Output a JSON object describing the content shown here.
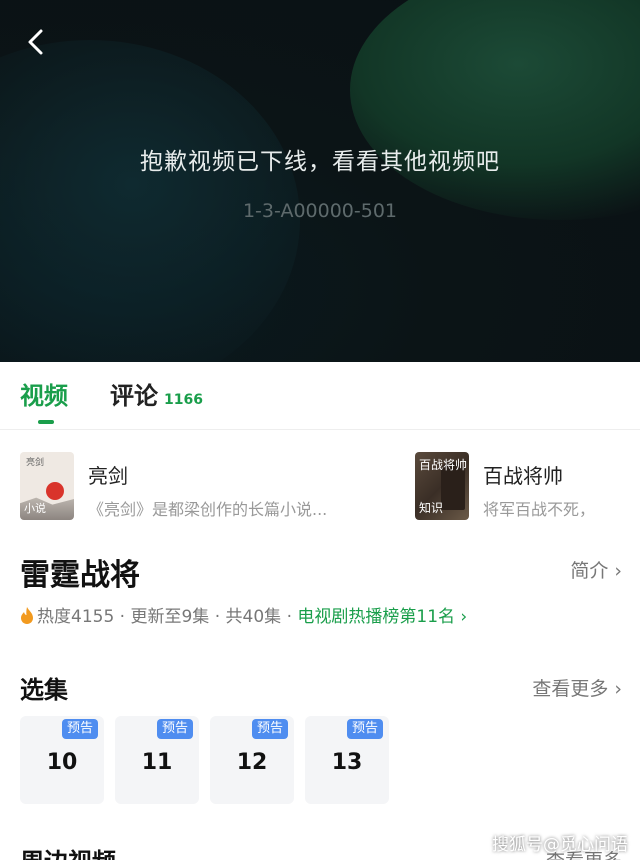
{
  "player": {
    "message": "抱歉视频已下线，看看其他视频吧",
    "error_code": "1-3-A00000-501",
    "back_icon": "chevron-left-icon"
  },
  "tabs": [
    {
      "label": "视频",
      "active": true
    },
    {
      "label": "评论",
      "count": "1166",
      "active": false
    }
  ],
  "related": [
    {
      "title": "亮剑",
      "desc": "《亮剑》是都梁创作的长篇小说...",
      "thumb_tag": "小说",
      "thumb_text": "亮剑"
    },
    {
      "title": "百战将帅",
      "desc": "将军百战不死，",
      "thumb_tag": "知识",
      "thumb_text": "百战将帅"
    }
  ],
  "show": {
    "title": "雷霆战将",
    "intro_label": "简介",
    "heat": "热度4155",
    "update": "更新至9集",
    "total": "共40集",
    "rank": "电视剧热播榜第11名"
  },
  "episodes_section": {
    "title": "选集",
    "more_label": "查看更多",
    "items": [
      {
        "number": "10",
        "badge": "预告"
      },
      {
        "number": "11",
        "badge": "预告"
      },
      {
        "number": "12",
        "badge": "预告"
      },
      {
        "number": "13",
        "badge": "预告"
      }
    ]
  },
  "nearby_section": {
    "title": "周边视频",
    "more_label": "查看更多"
  },
  "watermark": "搜狐号@觅心问语",
  "colors": {
    "accent": "#1a9e4b",
    "badge": "#4f8df0",
    "heat": "#f29a1f"
  }
}
